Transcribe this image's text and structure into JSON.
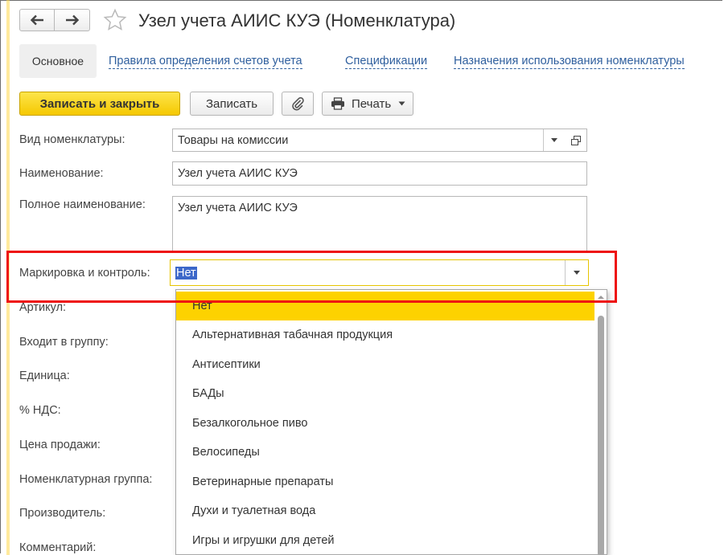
{
  "window": {
    "title": "Узел учета АИИС КУЭ (Номенклатура)"
  },
  "nav": {
    "back_icon": "arrow-left-icon",
    "forward_icon": "arrow-right-icon",
    "favorite_icon": "star-icon"
  },
  "tabs": [
    {
      "label": "Основное",
      "active": true
    },
    {
      "label": "Правила определения счетов учета"
    },
    {
      "label": "Спецификации"
    },
    {
      "label": "Назначения использования номенклатуры"
    }
  ],
  "toolbar": {
    "save_close": "Записать и закрыть",
    "save": "Записать",
    "attach_icon": "paperclip-icon",
    "print": "Печать",
    "print_icon": "printer-icon"
  },
  "form": {
    "nomenclature_type": {
      "label": "Вид номенклатуры:",
      "value": "Товары на комиссии"
    },
    "name": {
      "label": "Наименование:",
      "value": "Узел учета АИИС КУЭ"
    },
    "full_name": {
      "label": "Полное наименование:",
      "value": "Узел учета АИИС КУЭ"
    },
    "marking": {
      "label": "Маркировка и контроль:",
      "value": "Нет"
    },
    "article": {
      "label": "Артикул:"
    },
    "group": {
      "label": "Входит в группу:"
    },
    "unit": {
      "label": "Единица:"
    },
    "vat": {
      "label": "% НДС:"
    },
    "price": {
      "label": "Цена продажи:"
    },
    "nom_group": {
      "label": "Номенклатурная группа:"
    },
    "manufacturer": {
      "label": "Производитель:"
    },
    "comment": {
      "label": "Комментарий:"
    }
  },
  "dropdown": {
    "items": [
      "Нет",
      "Альтернативная табачная продукция",
      "Антисептики",
      "БАДы",
      "Безалкогольное пиво",
      "Велосипеды",
      "Ветеринарные препараты",
      "Духи и туалетная вода",
      "Игры и игрушки для детей"
    ],
    "selected_index": 0
  },
  "colors": {
    "primary_button": "#f5c800",
    "link": "#2f5f9e",
    "highlight": "#ee1111",
    "selected_item": "#fdd200"
  }
}
